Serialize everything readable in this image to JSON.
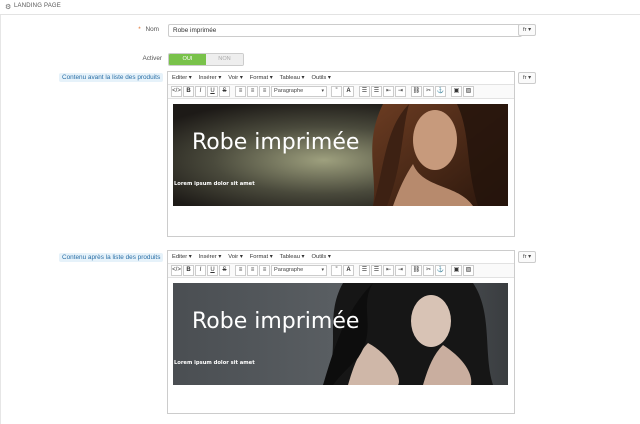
{
  "section": {
    "title": "LANDING PAGE",
    "icon": "gear-icon"
  },
  "fields": {
    "name_label": "Nom",
    "name_required_marker": "*",
    "name_value": "Robe imprimée",
    "lang_code": "fr",
    "active_label": "Activer",
    "active_on": "OUI",
    "active_off": "NON",
    "before_label": "Contenu avant la liste des produits",
    "after_label": "Contenu après la liste des produits"
  },
  "editor": {
    "menus": [
      "Editer ▾",
      "Insérer ▾",
      "Voir ▾",
      "Format ▾",
      "Tableau ▾",
      "Outils ▾"
    ],
    "paragraph_select": "Paragraphe",
    "buttons_a": [
      "</>",
      "B",
      "I",
      "U",
      "S"
    ],
    "buttons_b": [
      "≡",
      "≡",
      "≡"
    ],
    "buttons_c": [
      "”",
      "A"
    ],
    "buttons_d": [
      "☰",
      "☰",
      "⇤",
      "⇥",
      "⛓",
      "✂",
      "⚓",
      "▣",
      "▨"
    ]
  },
  "banners": [
    {
      "headline": "Robe imprimée",
      "sub": "Lorem ipsum dolor sit amet"
    },
    {
      "headline": "Robe imprimée",
      "sub": "Lorem ipsum dolor sit amet"
    }
  ],
  "colors": {
    "accent_on": "#79c24a",
    "label_highlight": "#e6f2fa",
    "label_text": "#2a6fa6"
  }
}
